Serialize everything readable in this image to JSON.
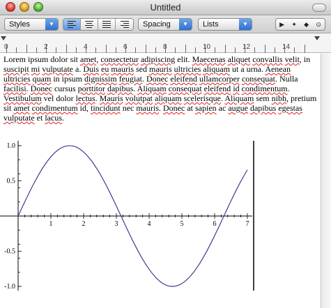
{
  "window": {
    "title": "Untitled"
  },
  "format_bar": {
    "styles_label": "Styles",
    "spacing_label": "Spacing",
    "lists_label": "Lists",
    "alignment": [
      "align-left",
      "align-center",
      "justify",
      "align-right"
    ],
    "selected_alignment": "align-left"
  },
  "ruler": {
    "labels": [
      "0",
      "2",
      "4",
      "6",
      "8",
      "10",
      "12",
      "14"
    ]
  },
  "document": {
    "text_runs": [
      [
        "Lorem ipsum dolor sit ",
        false
      ],
      [
        "amet",
        true
      ],
      [
        ", ",
        false
      ],
      [
        "consectetur",
        true
      ],
      [
        " ",
        false
      ],
      [
        "adipiscing",
        true
      ],
      [
        " elit. ",
        false
      ],
      [
        "Maecenas",
        true
      ],
      [
        " ",
        false
      ],
      [
        "aliquet",
        true
      ],
      [
        " ",
        false
      ],
      [
        "convallis",
        true
      ],
      [
        " ",
        false
      ],
      [
        "velit",
        true
      ],
      [
        ", in ",
        false
      ],
      [
        "suscipit",
        true
      ],
      [
        " ",
        false
      ],
      [
        "mi",
        true
      ],
      [
        " ",
        false
      ],
      [
        "vulputate",
        true
      ],
      [
        " a. ",
        false
      ],
      [
        "Duis",
        true
      ],
      [
        " ",
        false
      ],
      [
        "eu",
        true
      ],
      [
        " ",
        false
      ],
      [
        "mauris",
        true
      ],
      [
        " sed ",
        false
      ],
      [
        "mauris",
        true
      ],
      [
        " ",
        false
      ],
      [
        "ultricies",
        true
      ],
      [
        " ",
        false
      ],
      [
        "aliquam",
        true
      ],
      [
        " ut a urna. ",
        false
      ],
      [
        "Aenean",
        true
      ],
      [
        " ",
        false
      ],
      [
        "ultricies",
        true
      ],
      [
        " ",
        false
      ],
      [
        "quam",
        true
      ],
      [
        " in ipsum ",
        false
      ],
      [
        "dignissim",
        true
      ],
      [
        " ",
        false
      ],
      [
        "feugiat",
        true
      ],
      [
        ". ",
        false
      ],
      [
        "Donec",
        true
      ],
      [
        " ",
        false
      ],
      [
        "eleifend",
        true
      ],
      [
        " ",
        false
      ],
      [
        "ullamcorper",
        true
      ],
      [
        " ",
        false
      ],
      [
        "consequat",
        true
      ],
      [
        ". Nulla ",
        false
      ],
      [
        "facilisi",
        true
      ],
      [
        ". ",
        false
      ],
      [
        "Donec",
        true
      ],
      [
        " cursus ",
        false
      ],
      [
        "porttitor",
        true
      ],
      [
        " ",
        false
      ],
      [
        "dapibus",
        true
      ],
      [
        ". ",
        false
      ],
      [
        "Aliquam",
        true
      ],
      [
        " ",
        false
      ],
      [
        "consequat",
        true
      ],
      [
        " ",
        false
      ],
      [
        "eleifend",
        true
      ],
      [
        " ",
        false
      ],
      [
        "id",
        true
      ],
      [
        " ",
        false
      ],
      [
        "condimentum",
        true
      ],
      [
        ". ",
        false
      ],
      [
        "Vestibulum",
        true
      ],
      [
        " ",
        false
      ],
      [
        "vel dolor ",
        false
      ],
      [
        "lectus",
        true
      ],
      [
        ". ",
        false
      ],
      [
        "Mauris",
        true
      ],
      [
        " ",
        false
      ],
      [
        "volutpat",
        true
      ],
      [
        " ",
        false
      ],
      [
        "aliquam",
        true
      ],
      [
        " ",
        false
      ],
      [
        "scelerisque",
        true
      ],
      [
        ". ",
        false
      ],
      [
        "Aliquam",
        true
      ],
      [
        " sem ",
        false
      ],
      [
        "nibh",
        true
      ],
      [
        ", pretium sit ",
        false
      ],
      [
        "amet",
        true
      ],
      [
        " ",
        false
      ],
      [
        "condimentum",
        true
      ],
      [
        " id, ",
        false
      ],
      [
        "tincidunt",
        true
      ],
      [
        " nec ",
        false
      ],
      [
        "mauris",
        true
      ],
      [
        ". ",
        false
      ],
      [
        "Donec",
        true
      ],
      [
        " at ",
        false
      ],
      [
        "sapien",
        true
      ],
      [
        " ac ",
        false
      ],
      [
        "augue",
        true
      ],
      [
        " ",
        false
      ],
      [
        "dapibus",
        true
      ],
      [
        " ",
        false
      ],
      [
        "egestas",
        true
      ],
      [
        " ",
        false
      ],
      [
        "vulputate",
        true
      ],
      [
        " et ",
        false
      ],
      [
        "lacus",
        true
      ],
      [
        ".",
        false
      ]
    ]
  },
  "chart_data": {
    "type": "line",
    "function": "sin(x)",
    "series": [
      {
        "x": [
          0,
          0.25,
          0.5,
          0.75,
          1,
          1.25,
          1.5,
          1.75,
          2,
          2.25,
          2.5,
          2.75,
          3,
          3.25,
          3.5,
          3.75,
          4,
          4.25,
          4.5,
          4.75,
          5,
          5.25,
          5.5,
          5.75,
          6,
          6.25,
          6.5,
          6.75,
          7
        ],
        "y": [
          0,
          0.247,
          0.479,
          0.682,
          0.841,
          0.949,
          0.997,
          0.984,
          0.909,
          0.778,
          0.598,
          0.382,
          0.141,
          -0.108,
          -0.351,
          -0.572,
          -0.757,
          -0.895,
          -0.978,
          -0.999,
          -0.959,
          -0.859,
          -0.706,
          -0.508,
          -0.279,
          -0.033,
          0.215,
          0.45,
          0.657
        ]
      }
    ],
    "x_ticks": [
      "1",
      "2",
      "3",
      "4",
      "5",
      "6",
      "7"
    ],
    "y_ticks": [
      "1.0",
      "0.5",
      "-0.5",
      "-1.0"
    ],
    "xlim": [
      0,
      7.1
    ],
    "ylim": [
      -1.05,
      1.05
    ],
    "line_color": "#3a3f8f"
  }
}
